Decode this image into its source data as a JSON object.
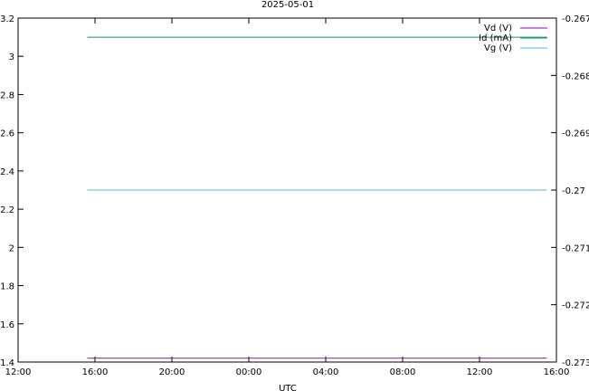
{
  "chart_data": {
    "type": "line",
    "title": "2025-05-01",
    "xlabel": "UTC",
    "ylabel": "",
    "y2label": "",
    "grid": false,
    "legend_position": "top-right",
    "x_ticks": [
      "12:00",
      "16:00",
      "20:00",
      "00:00",
      "04:00",
      "08:00",
      "12:00",
      "16:00"
    ],
    "xlim_hours": [
      0,
      28
    ],
    "ylim": [
      1.4,
      3.2
    ],
    "y_ticks": [
      1.4,
      1.6,
      1.8,
      2,
      2.2,
      2.4,
      2.6,
      2.8,
      3,
      3.2
    ],
    "y2lim": [
      -0.273,
      -0.267
    ],
    "y2_ticks": [
      -0.273,
      -0.272,
      -0.271,
      -0.27,
      -0.269,
      -0.268,
      -0.267
    ],
    "series": [
      {
        "name": "Vd (V)",
        "color": "#9400d3",
        "axis": "y",
        "x_hours": [
          3.6,
          27.5
        ],
        "values": [
          1.42,
          1.42
        ]
      },
      {
        "name": "Id (mA)",
        "color": "#009e73",
        "axis": "y",
        "x_hours": [
          3.6,
          27.5
        ],
        "values": [
          3.1,
          3.1
        ]
      },
      {
        "name": "Vg (V)",
        "color": "#56b4e9",
        "axis": "y2",
        "x_hours": [
          3.6,
          27.5
        ],
        "values": [
          -0.27,
          -0.27
        ]
      }
    ]
  }
}
